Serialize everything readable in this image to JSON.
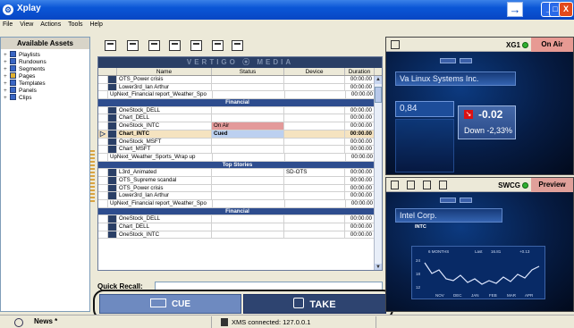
{
  "window": {
    "title": "Xplay",
    "restore_glyph": "→",
    "min_glyph": "_",
    "max_glyph": "□",
    "close_glyph": "X",
    "app_glyph": "⚙"
  },
  "menu": [
    "File",
    "View",
    "Actions",
    "Tools",
    "Help"
  ],
  "assets": {
    "title": "Available Assets",
    "items": [
      {
        "label": "Playlists",
        "icon": "playlist-icon"
      },
      {
        "label": "Rundowns",
        "icon": "rundown-icon"
      },
      {
        "label": "Segments",
        "icon": "segment-icon"
      },
      {
        "label": "Pages",
        "icon": "pages-icon"
      },
      {
        "label": "Templates",
        "icon": "template-icon"
      },
      {
        "label": "Panels",
        "icon": "panel-icon"
      },
      {
        "label": "Clips",
        "icon": "clip-icon"
      }
    ]
  },
  "grid": {
    "banner": "VERTIGO ⦿ MEDIA",
    "columns": {
      "name": "Name",
      "status": "Status",
      "device": "Device",
      "duration": "Duration"
    },
    "rows": [
      {
        "type": "item",
        "name": "OTS_Power crisis",
        "status": "",
        "device": "",
        "duration": "00:00.00"
      },
      {
        "type": "item",
        "name": "Lower3rd_Ian Arthur",
        "status": "",
        "device": "",
        "duration": "00:00.00"
      },
      {
        "type": "item",
        "long": true,
        "name": "UpNext_Financial report_Weather_Spo",
        "status": "",
        "device": "",
        "duration": "00:00.00"
      },
      {
        "type": "section",
        "name": "Financial"
      },
      {
        "type": "item",
        "name": "OneStock_DELL",
        "status": "",
        "device": "",
        "duration": "00:00.00"
      },
      {
        "type": "item",
        "name": "Chart_DELL",
        "status": "",
        "device": "",
        "duration": "00:00.00"
      },
      {
        "type": "item",
        "state": "onair",
        "name": "OneStock_INTC",
        "status": "On Air",
        "device": "",
        "duration": "00:00.00"
      },
      {
        "type": "item",
        "state": "cued",
        "name": "Chart_INTC",
        "status": "Cued",
        "device": "",
        "duration": "00:00.00"
      },
      {
        "type": "item",
        "name": "OneStock_MSFT",
        "status": "",
        "device": "",
        "duration": "00:00.00"
      },
      {
        "type": "item",
        "name": "Chart_MSFT",
        "status": "",
        "device": "",
        "duration": "00:00.00"
      },
      {
        "type": "item",
        "long": true,
        "name": "UpNext_Weather_Sports_Wrap up",
        "status": "",
        "device": "",
        "duration": "00:00.00"
      },
      {
        "type": "section",
        "name": "Top Stories"
      },
      {
        "type": "item",
        "name": "L3rd_Animated",
        "status": "",
        "device": "SD-OTS",
        "duration": "00:00.00"
      },
      {
        "type": "item",
        "name": "OTS_Supreme scandal",
        "status": "",
        "device": "",
        "duration": "00:00.00"
      },
      {
        "type": "item",
        "name": "OTS_Power crisis",
        "status": "",
        "device": "",
        "duration": "00:00.00"
      },
      {
        "type": "item",
        "name": "Lower3rd_Ian Arthur",
        "status": "",
        "device": "",
        "duration": "00:00.00"
      },
      {
        "type": "item",
        "long": true,
        "name": "UpNext_Financial report_Weather_Spo",
        "status": "",
        "device": "",
        "duration": "00:00.00"
      },
      {
        "type": "section",
        "name": "Financial"
      },
      {
        "type": "item",
        "name": "OneStock_DELL",
        "status": "",
        "device": "",
        "duration": "00:00.00"
      },
      {
        "type": "item",
        "name": "Chart_DELL",
        "status": "",
        "device": "",
        "duration": "00:00.00"
      },
      {
        "type": "item",
        "name": "OneStock_INTC",
        "status": "",
        "device": "",
        "duration": "00:00.00"
      }
    ]
  },
  "quick_recall": {
    "label": "Quick Recall:",
    "value": ""
  },
  "actions": {
    "cue": "CUE",
    "take": "TAKE"
  },
  "onair_pane": {
    "source": "XG1",
    "badge": "On Air",
    "company": "Va Linux Systems Inc.",
    "price": "0,84",
    "change": "-0.02",
    "change_pct": "Down -2,33%",
    "down_glyph": "↘"
  },
  "preview_pane": {
    "source": "SWCG",
    "badge": "Preview",
    "company": "Intel Corp.",
    "ticker": "INTC",
    "chart_caption": "6 MONTHS",
    "chart_last_label": "Last",
    "chart_last_value": "16.81",
    "chart_change_value": "+0.13",
    "y_ticks": [
      "24",
      "18",
      "12"
    ],
    "x_ticks": [
      "NOV",
      "DEC",
      "JAN",
      "FEB",
      "MAR",
      "APR"
    ]
  },
  "status": {
    "news": "News *",
    "xms": "XMS connected: 127.0.0.1"
  },
  "colors": {
    "titlebar": "#0a56d6",
    "section": "#2e4d8e",
    "onair": "#e39a9a",
    "cued": "#f5e3c0",
    "take": "#2e4470",
    "cue": "#6e8ac0"
  }
}
